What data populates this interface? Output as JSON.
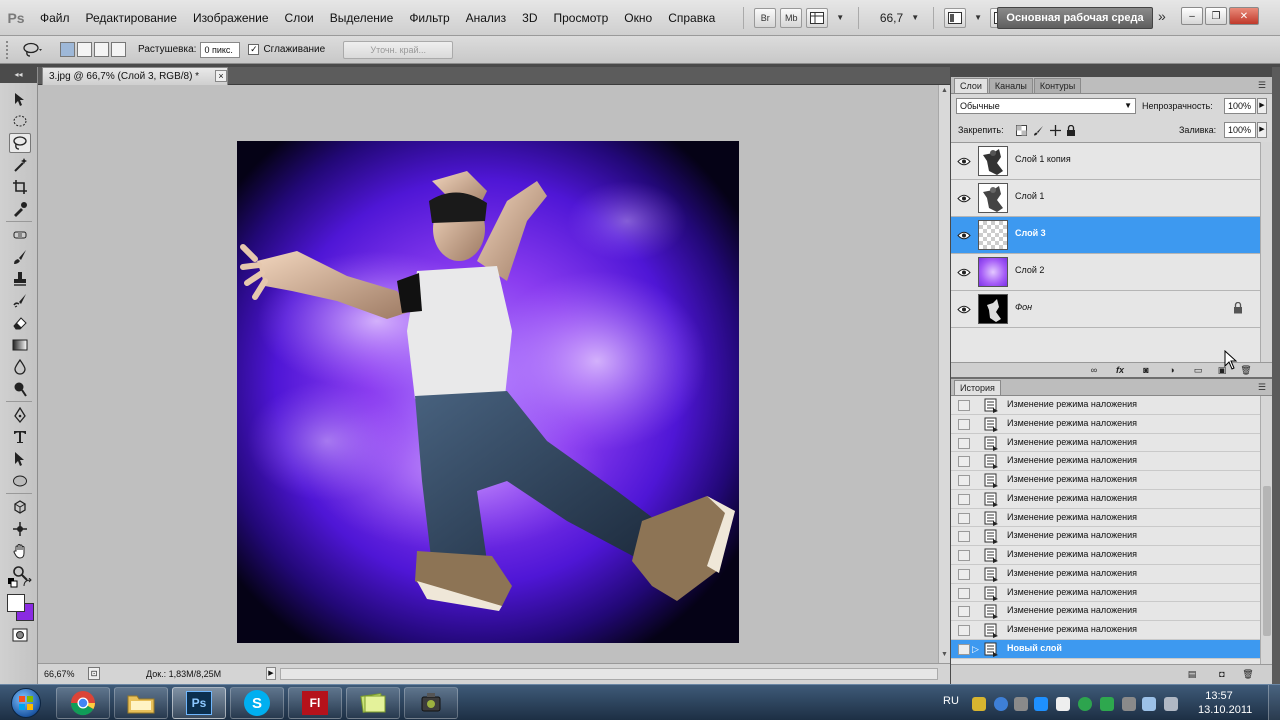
{
  "menubar": {
    "logo": "Ps",
    "items": [
      "Файл",
      "Редактирование",
      "Изображение",
      "Слои",
      "Выделение",
      "Фильтр",
      "Анализ",
      "3D",
      "Просмотр",
      "Окно",
      "Справка"
    ],
    "bridge_label": "Br",
    "minibridge_label": "Mb",
    "zoom": "66,7",
    "workspace": "Основная рабочая среда",
    "more": "»"
  },
  "options": {
    "feather_label": "Растушевка:",
    "feather_value": "0 пикс.",
    "antialias_label": "Сглаживание",
    "antialias_checked": "✓",
    "refine_edge_label": "Уточн. край..."
  },
  "document": {
    "tab_title": "3.jpg @ 66,7% (Слой 3, RGB/8) *",
    "tab_close": "×",
    "status_zoom": "66,67%",
    "status_doc": "Док.: 1,83M/8,25M"
  },
  "layers_panel": {
    "tabs": [
      "Слои",
      "Каналы",
      "Контуры"
    ],
    "blend_mode": "Обычные",
    "opacity_label": "Непрозрачность:",
    "opacity_value": "100%",
    "lock_label": "Закрепить:",
    "fill_label": "Заливка:",
    "fill_value": "100%",
    "layers": [
      {
        "name": "Слой 1 копия",
        "active": false
      },
      {
        "name": "Слой 1",
        "active": false
      },
      {
        "name": "Слой 3",
        "active": true
      },
      {
        "name": "Слой 2",
        "active": false
      },
      {
        "name": "Фон",
        "active": false,
        "locked": true
      }
    ]
  },
  "history_panel": {
    "tab": "История",
    "items": [
      "Изменение режима наложения",
      "Изменение режима наложения",
      "Изменение режима наложения",
      "Изменение режима наложения",
      "Изменение режима наложения",
      "Изменение режима наложения",
      "Изменение режима наложения",
      "Изменение режима наложения",
      "Изменение режима наложения",
      "Изменение режима наложения",
      "Изменение режима наложения",
      "Изменение режима наложения",
      "Изменение режима наложения",
      "Новый слой"
    ],
    "active_index": 13
  },
  "taskbar": {
    "lang": "RU",
    "time": "13:57",
    "date": "13.10.2011",
    "apps": [
      "chrome",
      "explorer",
      "photoshop",
      "skype",
      "flash",
      "notes",
      "media"
    ],
    "photoshop_label": "Ps",
    "flash_label": "Fl",
    "skype_label": "S"
  },
  "colors": {
    "selection": "#3d99f0",
    "canvas_bg": "#bfbfbf",
    "foreground": "#ffffff",
    "background": "#8a2be2"
  }
}
